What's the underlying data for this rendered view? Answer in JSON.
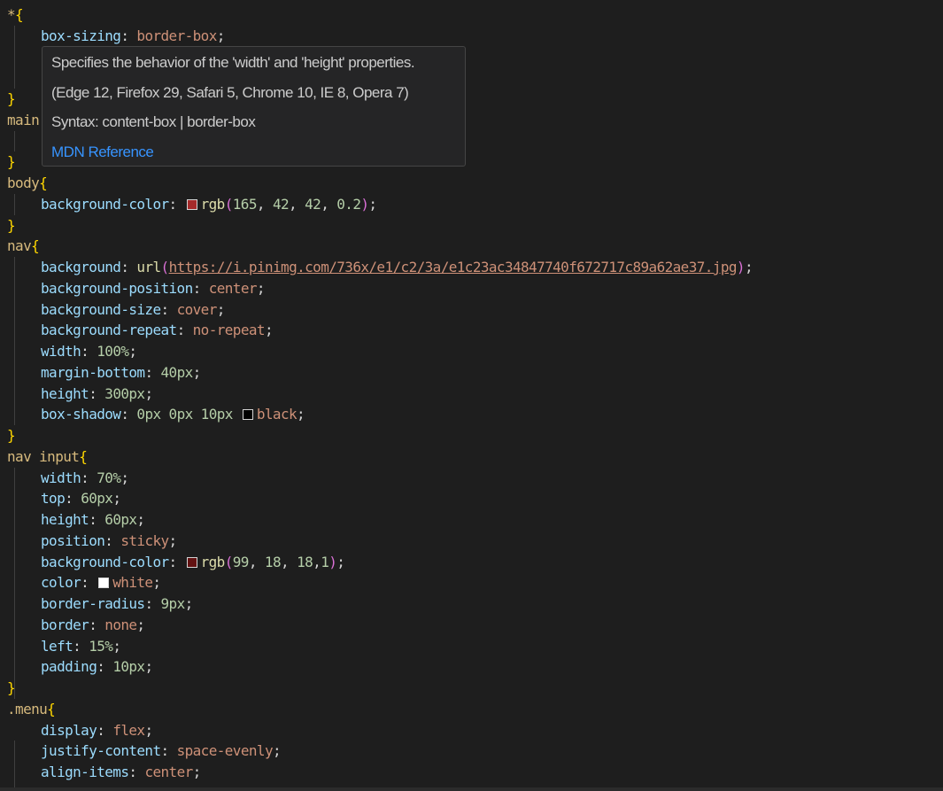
{
  "editor": {
    "lines": [
      {
        "indent": 0,
        "tokens": [
          {
            "t": "*",
            "c": "sel"
          },
          {
            "t": "{",
            "c": "b1"
          }
        ]
      },
      {
        "indent": 1,
        "tokens": [
          {
            "t": "box-sizing",
            "c": "prop"
          },
          {
            "t": ": ",
            "c": "punc"
          },
          {
            "t": "border-box",
            "c": "val"
          },
          {
            "t": ";",
            "c": "punc"
          }
        ]
      },
      {
        "indent": 1,
        "tokens": []
      },
      {
        "indent": 1,
        "tokens": []
      },
      {
        "indent": 0,
        "tokens": [
          {
            "t": "}",
            "c": "b1"
          }
        ]
      },
      {
        "indent": 0,
        "tokens": [
          {
            "t": "main",
            "c": "sel"
          }
        ]
      },
      {
        "indent": 1,
        "tokens": []
      },
      {
        "indent": 0,
        "tokens": [
          {
            "t": "}",
            "c": "b1"
          }
        ]
      },
      {
        "indent": 0,
        "tokens": [
          {
            "t": "body",
            "c": "sel"
          },
          {
            "t": "{",
            "c": "b1"
          }
        ]
      },
      {
        "indent": 1,
        "tokens": [
          {
            "t": "background-color",
            "c": "prop"
          },
          {
            "t": ": ",
            "c": "punc"
          },
          {
            "swatch": "#a52a2a"
          },
          {
            "t": "rgb",
            "c": "fn"
          },
          {
            "t": "(",
            "c": "b2"
          },
          {
            "t": "165",
            "c": "num"
          },
          {
            "t": ", ",
            "c": "punc"
          },
          {
            "t": "42",
            "c": "num"
          },
          {
            "t": ", ",
            "c": "punc"
          },
          {
            "t": "42",
            "c": "num"
          },
          {
            "t": ", ",
            "c": "punc"
          },
          {
            "t": "0.2",
            "c": "num"
          },
          {
            "t": ")",
            "c": "b2"
          },
          {
            "t": ";",
            "c": "punc"
          }
        ]
      },
      {
        "indent": 0,
        "tokens": [
          {
            "t": "}",
            "c": "b1"
          }
        ]
      },
      {
        "indent": 0,
        "tokens": [
          {
            "t": "nav",
            "c": "sel"
          },
          {
            "t": "{",
            "c": "b1"
          }
        ]
      },
      {
        "indent": 1,
        "tokens": [
          {
            "t": "background",
            "c": "prop"
          },
          {
            "t": ": ",
            "c": "punc"
          },
          {
            "t": "url",
            "c": "fn"
          },
          {
            "t": "(",
            "c": "b2"
          },
          {
            "t": "https://i.pinimg.com/736x/e1/c2/3a/e1c23ac34847740f672717c89a62ae37.jpg",
            "c": "url"
          },
          {
            "t": ")",
            "c": "b2"
          },
          {
            "t": ";",
            "c": "punc"
          }
        ]
      },
      {
        "indent": 1,
        "tokens": [
          {
            "t": "background-position",
            "c": "prop"
          },
          {
            "t": ": ",
            "c": "punc"
          },
          {
            "t": "center",
            "c": "val"
          },
          {
            "t": ";",
            "c": "punc"
          }
        ]
      },
      {
        "indent": 1,
        "tokens": [
          {
            "t": "background-size",
            "c": "prop"
          },
          {
            "t": ": ",
            "c": "punc"
          },
          {
            "t": "cover",
            "c": "val"
          },
          {
            "t": ";",
            "c": "punc"
          }
        ]
      },
      {
        "indent": 1,
        "tokens": [
          {
            "t": "background-repeat",
            "c": "prop"
          },
          {
            "t": ": ",
            "c": "punc"
          },
          {
            "t": "no-repeat",
            "c": "val"
          },
          {
            "t": ";",
            "c": "punc"
          }
        ]
      },
      {
        "indent": 1,
        "tokens": [
          {
            "t": "width",
            "c": "prop"
          },
          {
            "t": ": ",
            "c": "punc"
          },
          {
            "t": "100%",
            "c": "num"
          },
          {
            "t": ";",
            "c": "punc"
          }
        ]
      },
      {
        "indent": 1,
        "tokens": [
          {
            "t": "margin-bottom",
            "c": "prop"
          },
          {
            "t": ": ",
            "c": "punc"
          },
          {
            "t": "40px",
            "c": "num"
          },
          {
            "t": ";",
            "c": "punc"
          }
        ]
      },
      {
        "indent": 1,
        "tokens": [
          {
            "t": "height",
            "c": "prop"
          },
          {
            "t": ": ",
            "c": "punc"
          },
          {
            "t": "300px",
            "c": "num"
          },
          {
            "t": ";",
            "c": "punc"
          }
        ]
      },
      {
        "indent": 1,
        "tokens": [
          {
            "t": "box-shadow",
            "c": "prop"
          },
          {
            "t": ": ",
            "c": "punc"
          },
          {
            "t": "0px 0px 10px ",
            "c": "num"
          },
          {
            "swatch": "#000000"
          },
          {
            "t": "black",
            "c": "val"
          },
          {
            "t": ";",
            "c": "punc"
          }
        ]
      },
      {
        "indent": 0,
        "tokens": [
          {
            "t": "}",
            "c": "b1"
          }
        ]
      },
      {
        "indent": 0,
        "tokens": [
          {
            "t": "nav input",
            "c": "sel"
          },
          {
            "t": "{",
            "c": "b1"
          }
        ]
      },
      {
        "indent": 1,
        "tokens": [
          {
            "t": "width",
            "c": "prop"
          },
          {
            "t": ": ",
            "c": "punc"
          },
          {
            "t": "70%",
            "c": "num"
          },
          {
            "t": ";",
            "c": "punc"
          }
        ]
      },
      {
        "indent": 1,
        "tokens": [
          {
            "t": "top",
            "c": "prop"
          },
          {
            "t": ": ",
            "c": "punc"
          },
          {
            "t": "60px",
            "c": "num"
          },
          {
            "t": ";",
            "c": "punc"
          }
        ]
      },
      {
        "indent": 1,
        "tokens": [
          {
            "t": "height",
            "c": "prop"
          },
          {
            "t": ": ",
            "c": "punc"
          },
          {
            "t": "60px",
            "c": "num"
          },
          {
            "t": ";",
            "c": "punc"
          }
        ]
      },
      {
        "indent": 1,
        "tokens": [
          {
            "t": "position",
            "c": "prop"
          },
          {
            "t": ": ",
            "c": "punc"
          },
          {
            "t": "sticky",
            "c": "val"
          },
          {
            "t": ";",
            "c": "punc"
          }
        ]
      },
      {
        "indent": 1,
        "tokens": [
          {
            "t": "background-color",
            "c": "prop"
          },
          {
            "t": ": ",
            "c": "punc"
          },
          {
            "swatch": "#631212"
          },
          {
            "t": "rgb",
            "c": "fn"
          },
          {
            "t": "(",
            "c": "b2"
          },
          {
            "t": "99",
            "c": "num"
          },
          {
            "t": ", ",
            "c": "punc"
          },
          {
            "t": "18",
            "c": "num"
          },
          {
            "t": ", ",
            "c": "punc"
          },
          {
            "t": "18",
            "c": "num"
          },
          {
            "t": ",",
            "c": "punc"
          },
          {
            "t": "1",
            "c": "num"
          },
          {
            "t": ")",
            "c": "b2"
          },
          {
            "t": ";",
            "c": "punc"
          }
        ]
      },
      {
        "indent": 1,
        "tokens": [
          {
            "t": "color",
            "c": "prop"
          },
          {
            "t": ": ",
            "c": "punc"
          },
          {
            "swatch": "#ffffff"
          },
          {
            "t": "white",
            "c": "val"
          },
          {
            "t": ";",
            "c": "punc"
          }
        ]
      },
      {
        "indent": 1,
        "tokens": [
          {
            "t": "border-radius",
            "c": "prop"
          },
          {
            "t": ": ",
            "c": "punc"
          },
          {
            "t": "9px",
            "c": "num"
          },
          {
            "t": ";",
            "c": "punc"
          }
        ]
      },
      {
        "indent": 1,
        "tokens": [
          {
            "t": "border",
            "c": "prop"
          },
          {
            "t": ": ",
            "c": "punc"
          },
          {
            "t": "none",
            "c": "val"
          },
          {
            "t": ";",
            "c": "punc"
          }
        ]
      },
      {
        "indent": 1,
        "tokens": [
          {
            "t": "left",
            "c": "prop"
          },
          {
            "t": ": ",
            "c": "punc"
          },
          {
            "t": "15%",
            "c": "num"
          },
          {
            "t": ";",
            "c": "punc"
          }
        ]
      },
      {
        "indent": 1,
        "tokens": [
          {
            "t": "padding",
            "c": "prop"
          },
          {
            "t": ": ",
            "c": "punc"
          },
          {
            "t": "10px",
            "c": "num"
          },
          {
            "t": ";",
            "c": "punc"
          }
        ]
      },
      {
        "indent": 0,
        "tokens": [
          {
            "t": "}",
            "c": "b1"
          }
        ]
      },
      {
        "indent": 0,
        "tokens": [
          {
            "t": ".menu",
            "c": "sel"
          },
          {
            "t": "{",
            "c": "b1"
          }
        ]
      },
      {
        "indent": 1,
        "tokens": [
          {
            "t": "display",
            "c": "prop"
          },
          {
            "t": ": ",
            "c": "punc"
          },
          {
            "t": "flex",
            "c": "val"
          },
          {
            "t": ";",
            "c": "punc"
          }
        ]
      },
      {
        "indent": 1,
        "tokens": [
          {
            "t": "justify-content",
            "c": "prop"
          },
          {
            "t": ": ",
            "c": "punc"
          },
          {
            "t": "space-evenly",
            "c": "val"
          },
          {
            "t": ";",
            "c": "punc"
          }
        ]
      },
      {
        "indent": 1,
        "tokens": [
          {
            "t": "align-items",
            "c": "prop"
          },
          {
            "t": ": ",
            "c": "punc"
          },
          {
            "t": "center",
            "c": "val"
          },
          {
            "t": ";",
            "c": "punc"
          }
        ]
      }
    ],
    "indent_guide_groups": [
      [
        1,
        3
      ],
      [
        6,
        6
      ],
      [
        9,
        9
      ],
      [
        12,
        19
      ],
      [
        22,
        32
      ],
      [
        35,
        37
      ]
    ]
  },
  "hover": {
    "description": "Specifies the behavior of the 'width' and 'height' properties.",
    "compat": "(Edge 12, Firefox 29, Safari 5, Chrome 10, IE 8, Opera 7)",
    "syntax": "Syntax: content-box | border-box",
    "link": "MDN Reference"
  },
  "colors": {
    "background": "#1e1e1e",
    "selector": "#d7ba7d",
    "property": "#9cdcfe",
    "value": "#ce9178",
    "number": "#b5cea8",
    "function": "#dcdcaa",
    "bracket": "#ffd700",
    "paren": "#da70d6",
    "link": "#3794ff"
  }
}
